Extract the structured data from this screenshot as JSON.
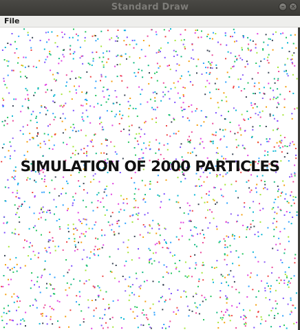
{
  "window": {
    "title": "Standard Draw",
    "minimize_glyph": "–",
    "close_glyph": "×"
  },
  "menubar": {
    "items": [
      {
        "label": "File"
      }
    ]
  },
  "canvas": {
    "overlay_text": "SIMULATION OF 2000 PARTICLES",
    "particle_count": 2000,
    "particle_colors": [
      "#e040e0",
      "#7a4cff",
      "#2aa0ff",
      "#22c55e",
      "#f59e0b",
      "#ef4444",
      "#06b6d4",
      "#a3e635",
      "#374151",
      "#ec4899",
      "#8b5cf6",
      "#10b981"
    ]
  }
}
